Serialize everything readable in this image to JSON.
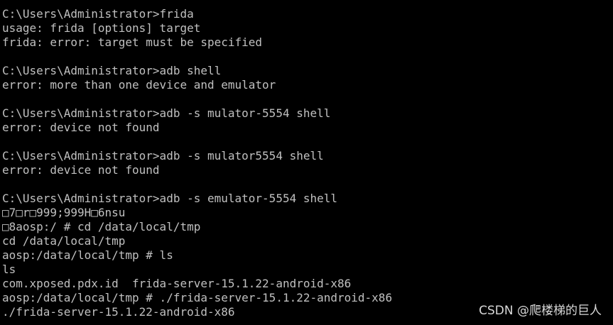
{
  "terminal": {
    "lines": [
      "C:\\Users\\Administrator>frida",
      "usage: frida [options] target",
      "frida: error: target must be specified",
      "",
      "C:\\Users\\Administrator>adb shell",
      "error: more than one device and emulator",
      "",
      "C:\\Users\\Administrator>adb -s mulator-5554 shell",
      "error: device not found",
      "",
      "C:\\Users\\Administrator>adb -s mulator5554 shell",
      "error: device not found",
      "",
      "C:\\Users\\Administrator>adb -s emulator-5554 shell",
      "□7□r□999;999H□6nsu",
      "□8aosp:/ # cd /data/local/tmp",
      "cd /data/local/tmp",
      "aosp:/data/local/tmp # ls",
      "ls",
      "com.xposed.pdx.id  frida-server-15.1.22-android-x86",
      "aosp:/data/local/tmp # ./frida-server-15.1.22-android-x86",
      "./frida-server-15.1.22-android-x86"
    ]
  },
  "watermark": {
    "text": "CSDN @爬楼梯的巨人"
  },
  "colors": {
    "background": "#000000",
    "text": "#c0c0c0",
    "watermark": "#d8d8d8"
  }
}
